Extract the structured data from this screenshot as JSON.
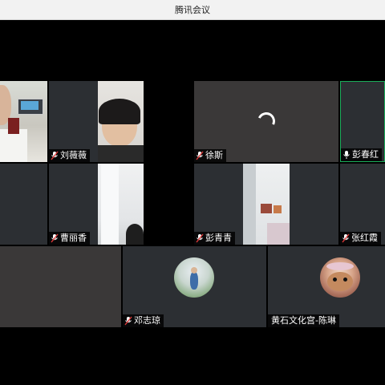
{
  "window": {
    "title": "腾讯会议"
  },
  "participants": [
    {
      "name": "",
      "muted": false
    },
    {
      "name": "刘薇薇",
      "muted": true
    },
    {
      "name": "徐斯",
      "muted": true,
      "state": "loading"
    },
    {
      "name": "彭春红",
      "muted": false,
      "speaking": true
    },
    {
      "name": "",
      "muted": false
    },
    {
      "name": "曹丽香",
      "muted": true
    },
    {
      "name": "彭青青",
      "muted": true
    },
    {
      "name": "张红霞",
      "muted": true
    },
    {
      "name": "",
      "muted": false
    },
    {
      "name": "邓志琼",
      "muted": true
    },
    {
      "name": "黄石文化宫-陈琳",
      "muted": false
    }
  ],
  "colors": {
    "tile_bg": "#2c2f33",
    "speaking_border": "#1aad5a",
    "title_bg": "#f2f2f2"
  }
}
